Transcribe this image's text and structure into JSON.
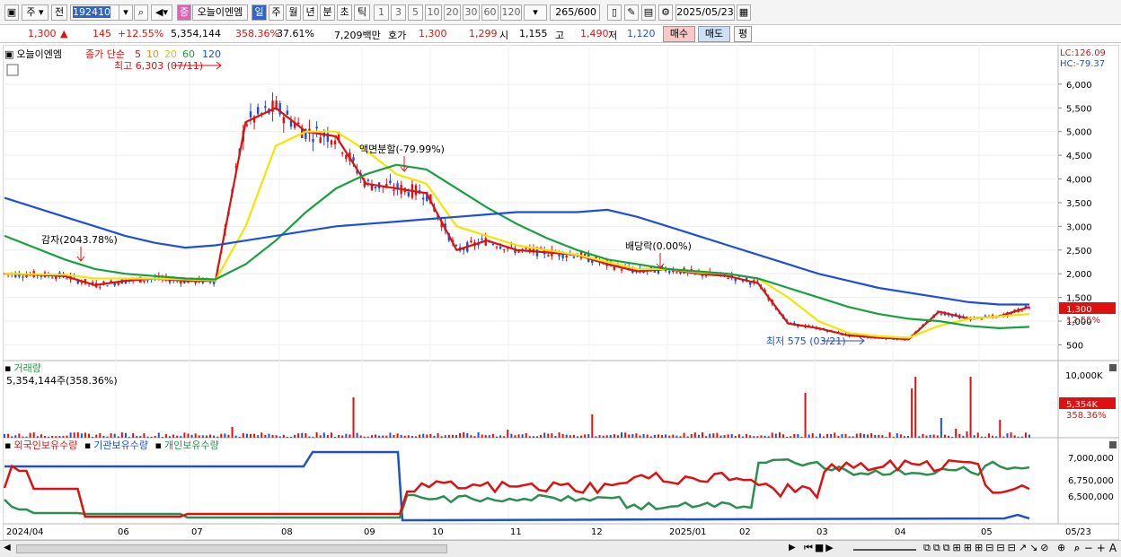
{
  "toolbar": {
    "period": "주",
    "view": "전",
    "code": "192410",
    "stock_name": "오늘이엔엠",
    "badge": "증",
    "tf_buttons": [
      "일",
      "주",
      "월",
      "년",
      "분",
      "초",
      "틱"
    ],
    "num_buttons": [
      "1",
      "3",
      "5",
      "10",
      "20",
      "30",
      "60",
      "120"
    ],
    "count": "265",
    "count_total": "/600",
    "date": "2025/05/23"
  },
  "quote": {
    "price": "1,300",
    "arrow": "▲",
    "change": "145",
    "change_pct": "+12.55%",
    "volume": "5,354,144",
    "vol_ratio": "358.36%",
    "turnover": "37.61%",
    "amount": "7,209백만",
    "ask_label": "호가",
    "ask": "1,300",
    "bid": "1,299",
    "open_label": "시",
    "open": "1,155",
    "high_label": "고",
    "high": "1,490",
    "low_label": "저",
    "low": "1,120",
    "buy": "매수",
    "sell": "매도",
    "eval": "평"
  },
  "price_panel": {
    "name": "오늘이엔엠",
    "ma_label": "종가 단순",
    "ma_periods": [
      "5",
      "10",
      "20",
      "60",
      "120"
    ],
    "ma_colors": [
      "#dd1111",
      "#f08c00",
      "#f2e600",
      "#18a040",
      "#1f4fd8"
    ],
    "lc": "LC:126.09",
    "hc": "HC:-79.37",
    "y_ticks": [
      "6,000",
      "5,500",
      "5,000",
      "4,500",
      "4,000",
      "3,500",
      "3,000",
      "2,500",
      "2,000",
      "1,500",
      "1,000",
      "500"
    ],
    "last_price": "1,300",
    "last_pct": "12.55%",
    "annotations": {
      "high": "최고 6,303 (07/11)",
      "low": "최저 575 (03/21)",
      "reduction": "감자(2043.78%)",
      "split": "액면분할(-79.99%)",
      "dividend": "배당락(0.00%)"
    }
  },
  "volume_panel": {
    "title": "거래량",
    "info": "5,354,144주(358.36%)",
    "y_tick": "10,000K",
    "last": "5,354K",
    "last_pct": "358.36%"
  },
  "holding_panel": {
    "series": [
      {
        "name": "외국인보유수량",
        "color": "#dd1111"
      },
      {
        "name": "기관보유수량",
        "color": "#2050d0"
      },
      {
        "name": "개인보유수량",
        "color": "#2a8f50"
      }
    ],
    "y_ticks": [
      "7,000,000",
      "6,750,000",
      "6,500,000"
    ]
  },
  "x_axis": [
    "2024/04",
    "06",
    "07",
    "08",
    "09",
    "10",
    "11",
    "12",
    "2025/01",
    "02",
    "03",
    "04",
    "05",
    "05/23"
  ],
  "chart_data": {
    "type": "line",
    "title": "오늘이엔엠",
    "ylabel": "",
    "ylim": [
      300,
      6300
    ],
    "x_labels": [
      "2024/04",
      "06",
      "07",
      "08",
      "09",
      "10",
      "11",
      "12",
      "2025/01",
      "02",
      "03",
      "04",
      "05"
    ],
    "series": [
      {
        "name": "5",
        "color": "#dd1111",
        "values": [
          2000,
          1980,
          1950,
          1760,
          1850,
          1900,
          1850,
          1850,
          5200,
          5500,
          5000,
          4900,
          3900,
          3800,
          3700,
          2500,
          2700,
          2500,
          2450,
          2400,
          2200,
          2050,
          2100,
          2000,
          1950,
          1800,
          950,
          850,
          700,
          650,
          620,
          1200,
          1050,
          1100,
          1300
        ]
      },
      {
        "name": "20",
        "color": "#f2e600",
        "values": [
          2000,
          1990,
          1980,
          1900,
          1900,
          1900,
          1880,
          1860,
          3000,
          4700,
          5000,
          5000,
          4600,
          4100,
          3900,
          3000,
          2800,
          2600,
          2500,
          2400,
          2250,
          2100,
          2100,
          2030,
          2000,
          1900,
          1500,
          1000,
          750,
          680,
          650,
          900,
          1050,
          1100,
          1150
        ]
      },
      {
        "name": "60",
        "color": "#18a040",
        "values": [
          2800,
          2550,
          2300,
          2100,
          2000,
          1950,
          1900,
          1880,
          2200,
          2700,
          3300,
          3800,
          4100,
          4300,
          4200,
          3800,
          3400,
          3050,
          2750,
          2500,
          2300,
          2200,
          2100,
          2050,
          2000,
          1900,
          1700,
          1500,
          1300,
          1150,
          1050,
          1000,
          900,
          850,
          880
        ]
      },
      {
        "name": "120",
        "color": "#1f4fd8",
        "values": [
          3600,
          3400,
          3200,
          3000,
          2800,
          2650,
          2550,
          2600,
          2700,
          2800,
          2900,
          3000,
          3050,
          3100,
          3150,
          3200,
          3250,
          3300,
          3300,
          3300,
          3350,
          3200,
          3000,
          2800,
          2600,
          2400,
          2200,
          2000,
          1850,
          1700,
          1600,
          1500,
          1400,
          1350,
          1350
        ]
      }
    ]
  }
}
